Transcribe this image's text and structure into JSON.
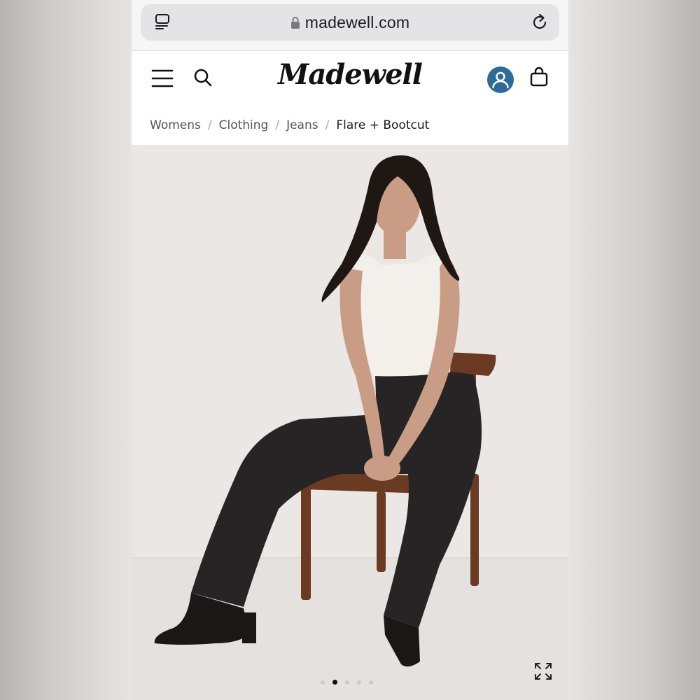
{
  "browser": {
    "url": "madewell.com"
  },
  "header": {
    "logo": "Madewell"
  },
  "breadcrumb": {
    "items": [
      {
        "label": "Womens"
      },
      {
        "label": "Clothing"
      },
      {
        "label": "Jeans"
      },
      {
        "label": "Flare + Bootcut"
      }
    ]
  },
  "gallery": {
    "current_image": 1,
    "total_images": 5
  },
  "colors": {
    "account_icon_bg": "#2f6b99",
    "image_bg": "#eae6e3"
  },
  "icons": [
    "tabs-icon",
    "lock-icon",
    "reload-icon",
    "menu-icon",
    "search-icon",
    "account-icon",
    "bag-icon",
    "expand-icon"
  ]
}
